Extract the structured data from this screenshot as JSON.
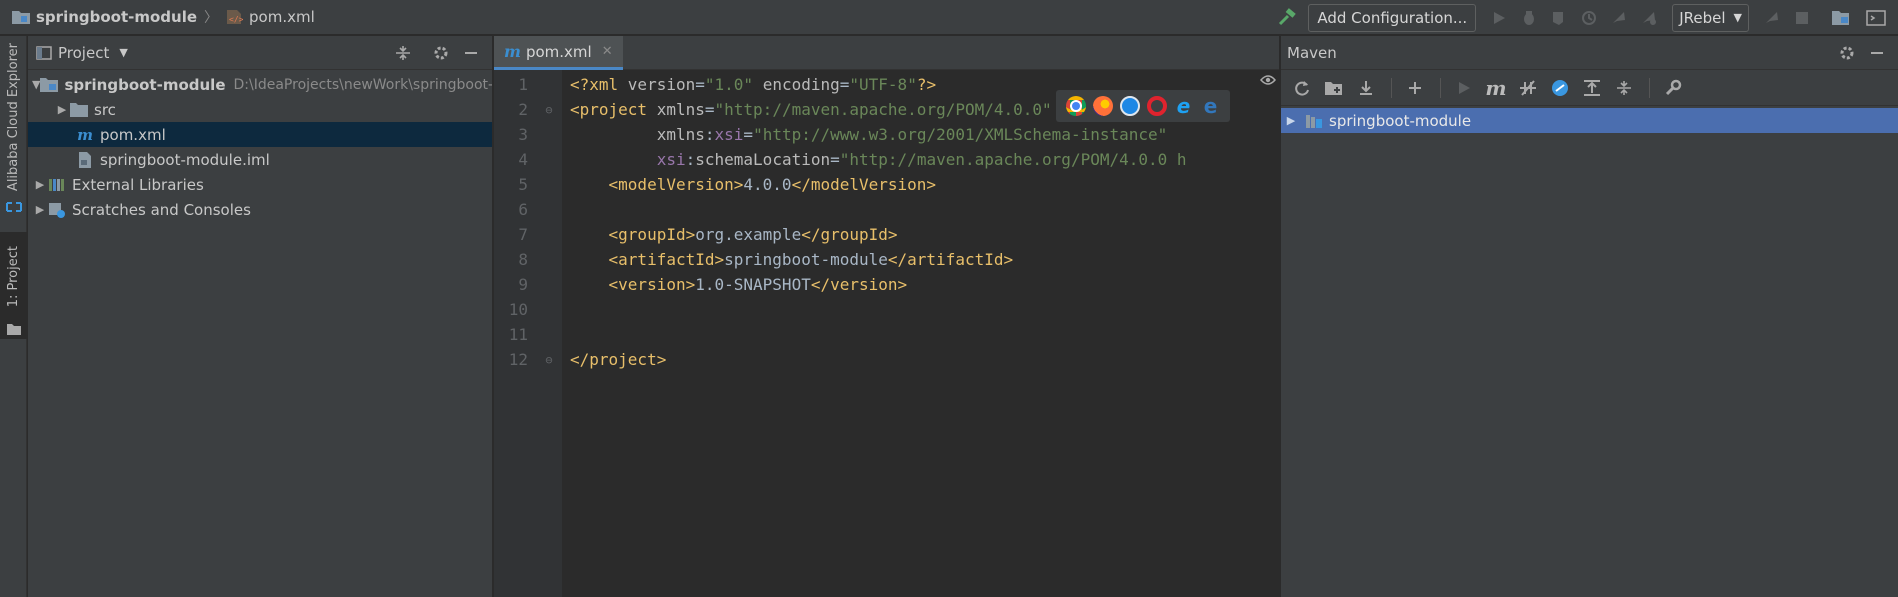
{
  "breadcrumb": {
    "project": "springboot-module",
    "file": "pom.xml"
  },
  "toolbar": {
    "add_configuration": "Add Configuration...",
    "jrebel_select": "JRebel",
    "icons": [
      "build-hammer-icon",
      "run-icon",
      "debug-icon",
      "coverage-icon",
      "profile-icon",
      "jrebel-run-icon",
      "jrebel-debug-icon",
      "jrebel-update-icon",
      "stop-icon",
      "project-structure-icon",
      "terminal-icon"
    ],
    "accent_build": "#59a869"
  },
  "left_strip": {
    "tab_cloud": "Alibaba Cloud Explorer",
    "tab_project": "1: Project"
  },
  "project_panel": {
    "title": "Project",
    "tree": [
      {
        "label": "springboot-module",
        "hint": "D:\\IdeaProjects\\newWork\\springboot-m",
        "icon": "module-folder-icon"
      },
      {
        "label": "src",
        "icon": "folder-icon"
      },
      {
        "label": "pom.xml",
        "icon": "maven-file-icon"
      },
      {
        "label": "springboot-module.iml",
        "icon": "iml-file-icon"
      },
      {
        "label": "External Libraries",
        "icon": "libraries-icon"
      },
      {
        "label": "Scratches and Consoles",
        "icon": "scratches-icon"
      }
    ]
  },
  "editor": {
    "tab_label": "pom.xml",
    "line_numbers": [
      "1",
      "2",
      "3",
      "4",
      "5",
      "6",
      "7",
      "8",
      "9",
      "10",
      "11",
      "12"
    ],
    "lines": {
      "l1": {
        "open": "<?xml ",
        "a1": "version",
        "eq1": "=",
        "v1": "\"1.0\"",
        "sp": " ",
        "a2": "encoding",
        "eq2": "=",
        "v2": "\"UTF-8\"",
        "close": "?>"
      },
      "l2": {
        "open": "<project ",
        "a1": "xmlns",
        "eq1": "=",
        "v1": "\"http://maven.apache.org/POM/4.0.0\""
      },
      "l3": {
        "indent": "         ",
        "ns": "xmlns",
        "colon": ":",
        "a1": "xsi",
        "eq1": "=",
        "v1": "\"http://www.w3.org/2001/XMLSchema-instance\""
      },
      "l4": {
        "indent": "         ",
        "ns": "xsi",
        "colon": ":",
        "a1": "schemaLocation",
        "eq1": "=",
        "v1": "\"http://maven.apache.org/POM/4.0.0 h"
      },
      "l5": {
        "indent": "    ",
        "open": "<modelVersion>",
        "text": "4.0.0",
        "close": "</modelVersion>"
      },
      "l7": {
        "indent": "    ",
        "open": "<groupId>",
        "text": "org.example",
        "close": "</groupId>"
      },
      "l8": {
        "indent": "    ",
        "open": "<artifactId>",
        "text": "springboot-module",
        "close": "</artifactId>"
      },
      "l9": {
        "indent": "    ",
        "open": "<version>",
        "text": "1.0-SNAPSHOT",
        "close": "</version>"
      },
      "l12": {
        "close": "</project>"
      }
    },
    "browser_icons": [
      "chrome-icon",
      "firefox-icon",
      "safari-icon",
      "opera-icon",
      "ie-icon",
      "edge-icon"
    ]
  },
  "maven_panel": {
    "title": "Maven",
    "toolbar_icons": [
      "reload-icon",
      "add-folder-icon",
      "download-icon",
      "plus-icon",
      "run-icon",
      "maven-goal-icon",
      "toggle-offline-icon",
      "skip-tests-icon",
      "show-dependencies-icon",
      "collapse-all-icon",
      "settings-wrench-icon"
    ],
    "tree_root": "springboot-module"
  },
  "colors": {
    "selection_blue": "#4b6eaf",
    "tab_underline": "#4a88c7",
    "xml_tag": "#e8bf6a",
    "xml_value": "#6a8759",
    "xml_namespace": "#9876aa"
  }
}
